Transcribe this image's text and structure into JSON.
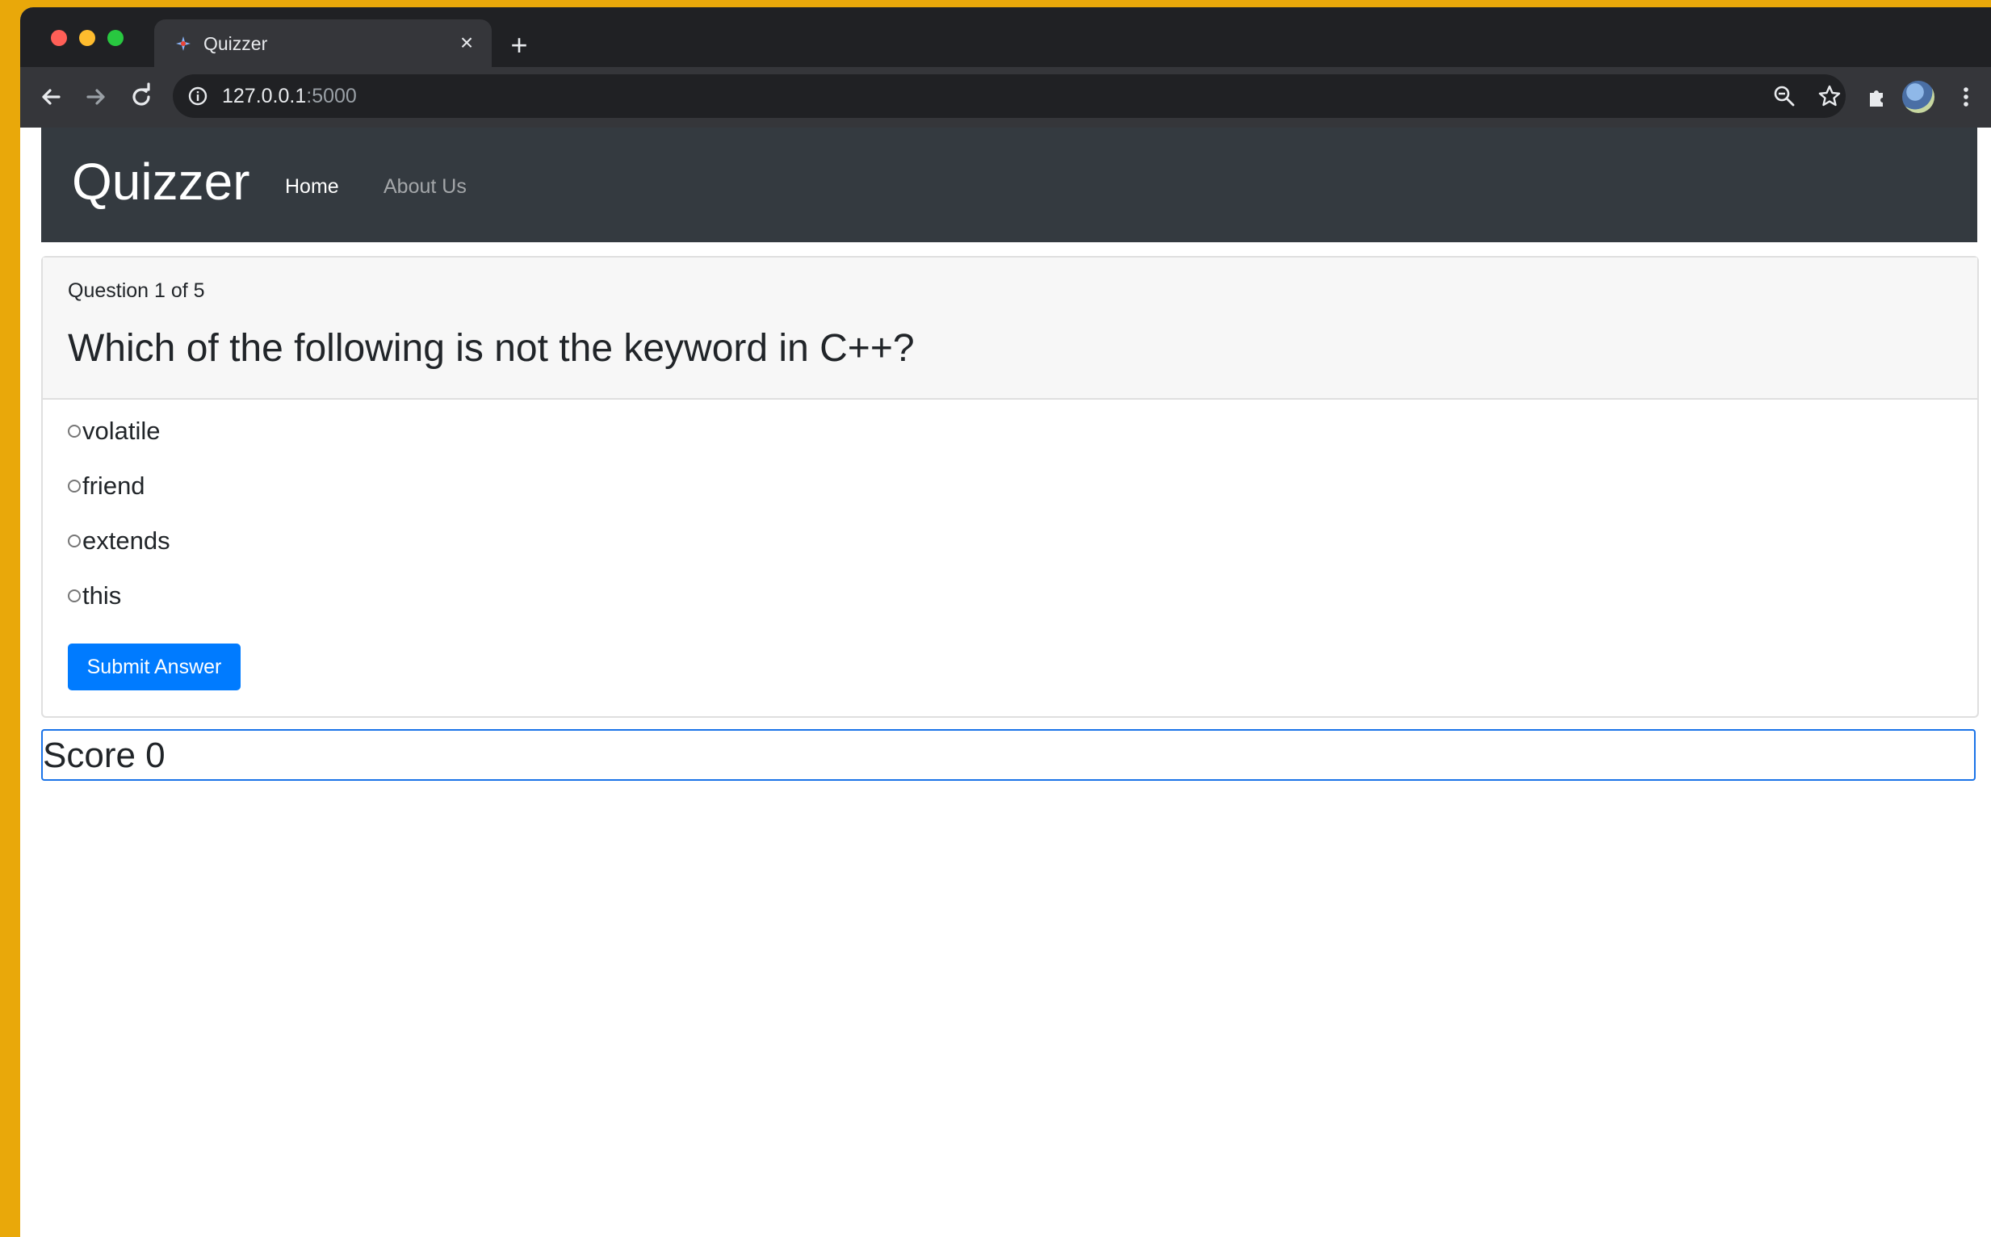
{
  "browser": {
    "tab_title": "Quizzer",
    "url_host": "127.0.0.1",
    "url_port": ":5000",
    "icons": [
      "back-arrow-icon",
      "forward-arrow-icon",
      "reload-icon",
      "info-icon",
      "zoom-icon",
      "star-icon",
      "extensions-icon",
      "avatar",
      "menu-icon"
    ]
  },
  "navbar": {
    "brand": "Quizzer",
    "links": [
      {
        "label": "Home",
        "active": true
      },
      {
        "label": "About Us",
        "active": false
      }
    ]
  },
  "quiz": {
    "counter": "Question 1 of 5",
    "question": "Which of the following is not the keyword in C++?",
    "options": [
      "volatile",
      "friend",
      "extends",
      "this"
    ],
    "submit_label": "Submit Answer"
  },
  "score": {
    "text": "Score 0"
  },
  "colors": {
    "navbar_bg": "#343a40",
    "primary": "#007bff",
    "focus_border": "#1a73e8"
  }
}
